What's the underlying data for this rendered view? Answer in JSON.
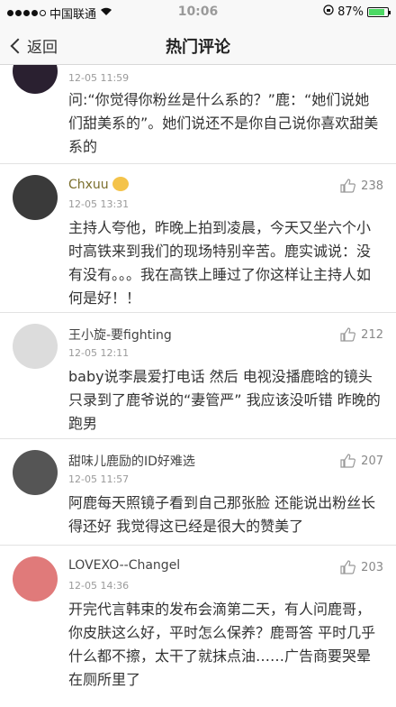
{
  "status": {
    "carrier": "中国联通",
    "time": "10:06",
    "battery": "87%",
    "battery_level": 0.87
  },
  "nav": {
    "back_label": "返回",
    "title": "热门评论"
  },
  "comments": [
    {
      "time": "12-05 11:59",
      "text": "问:“你觉得你粉丝是什么系的？”鹿：“她们说她们甜美系的”。她们说还不是你自己说你喜欢甜美系的"
    },
    {
      "name": "Chxuu",
      "time": "12-05 13:31",
      "likes": "238",
      "text": "主持人夸他，昨晚上拍到凌晨，今天又坐六个小时高铁来到我们的现场特别辛苦。鹿实诚说：没有没有。。。我在高铁上睡过了你这样让主持人如何是好！！"
    },
    {
      "name": "王小旋-要fighting",
      "time": "12-05 12:11",
      "likes": "212",
      "text": "baby说李晨爱打电话 然后 电视没播鹿晗的镜头 只录到了鹿爷说的“妻管严” 我应该没听错 昨晚的跑男"
    },
    {
      "name": "甜味儿鹿励的ID好难选",
      "time": "12-05 11:57",
      "likes": "207",
      "text": "阿鹿每天照镜子看到自己那张脸 还能说出粉丝长得还好 我觉得这已经是很大的赞美了"
    },
    {
      "name": "LOVEXO--Changel",
      "time": "12-05 14:36",
      "likes": "203",
      "text": "开完代言韩束的发布会滴第二天，有人问鹿哥，你皮肤这么好，平时怎么保养？鹿哥答 平时几乎什么都不擦，太干了就抹点油……广告商要哭晕在厕所里了"
    }
  ]
}
